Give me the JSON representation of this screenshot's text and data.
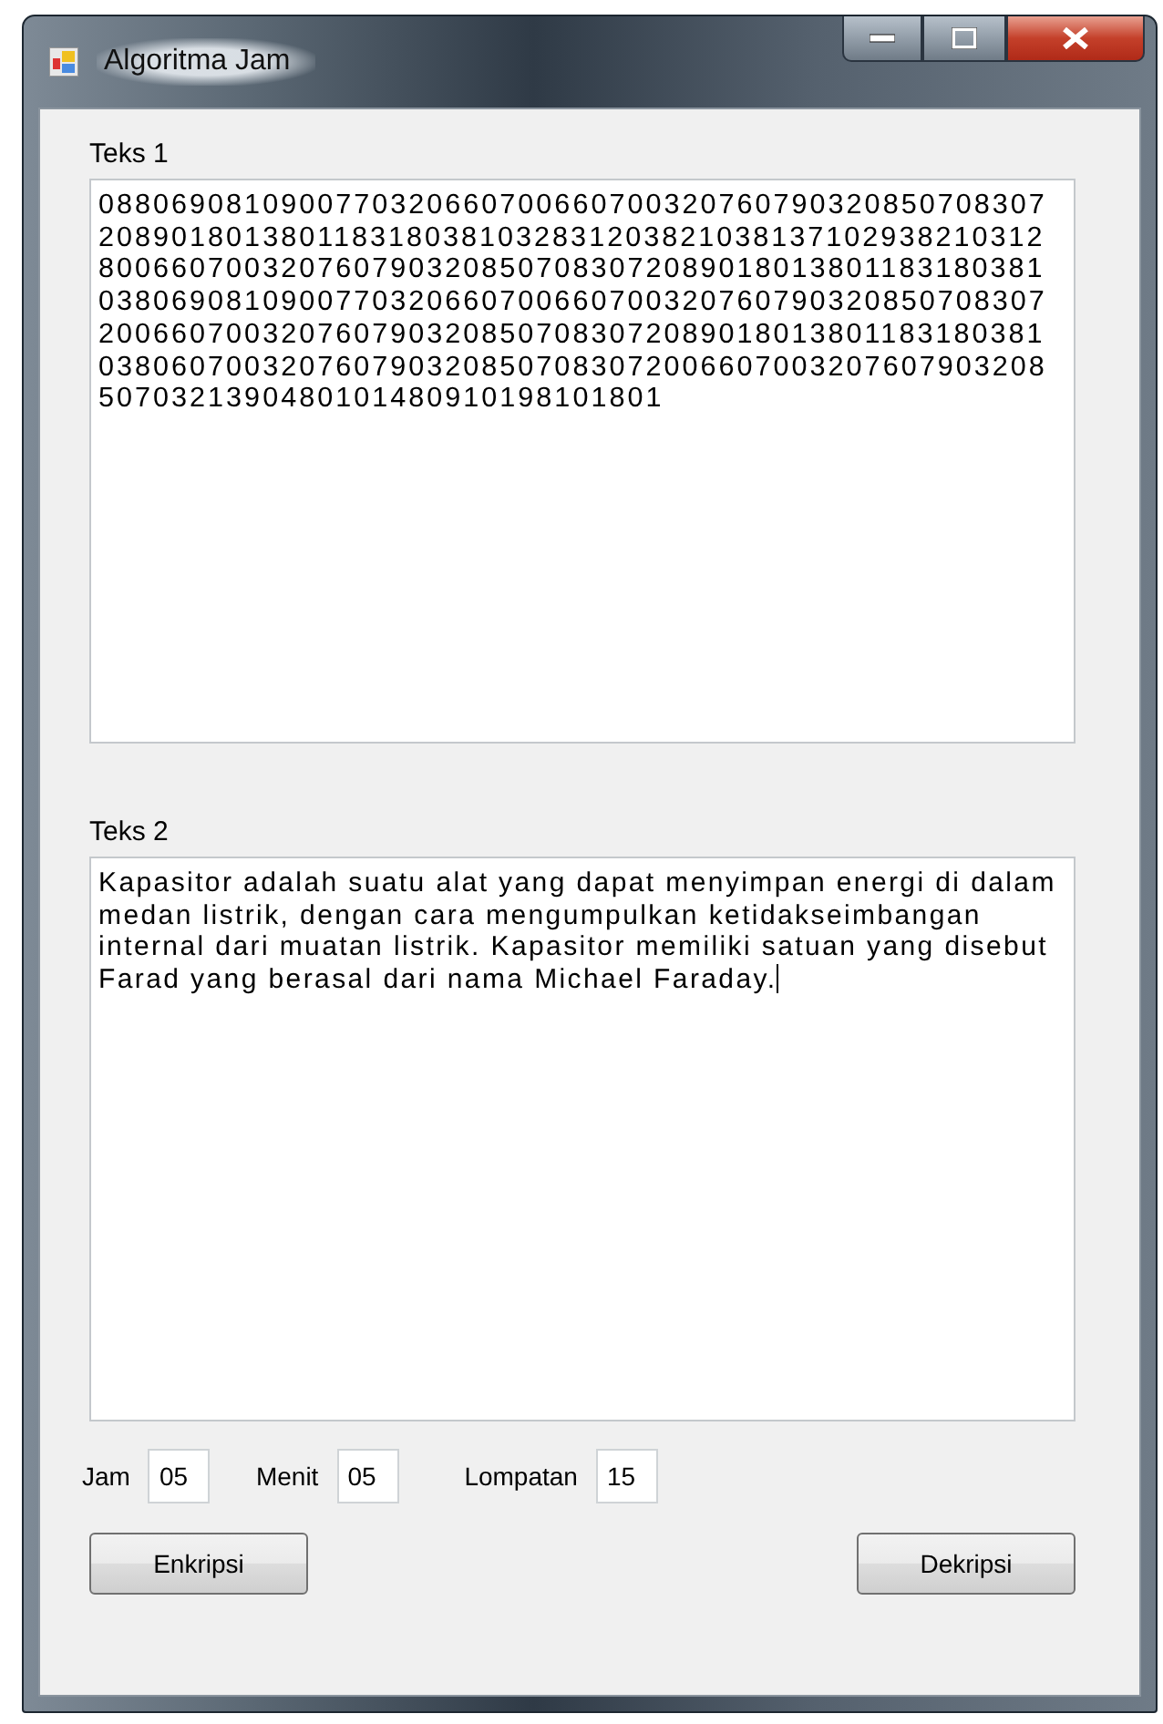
{
  "window": {
    "title": "Algoritma Jam"
  },
  "teks1": {
    "label": "Teks 1",
    "lines": [
      "0880690810900770320660700660700320760790320850708307",
      "2089018013801183180381032831203821038137102938210312",
      "8006607003207607903208507083072089018013801183180381",
      "0380690810900770320660700660700320760790320850708307",
      "2006607003207607903208507083072089018013801183180381",
      "0380607003207607903208507083072006607003207607903208",
      "5070321390480101480910198101801"
    ]
  },
  "teks2": {
    "label": "Teks 2",
    "lines": [
      "Kapasitor adalah suatu alat yang dapat menyimpan energi di dalam",
      "medan listrik, dengan cara mengumpulkan ketidakseimbangan",
      "internal dari muatan listrik. Kapasitor memiliki satuan yang disebut",
      "Farad yang berasal dari nama Michael Faraday."
    ],
    "caret": true
  },
  "fields": [
    {
      "label": "Jam",
      "value": "05"
    },
    {
      "label": "Menit",
      "value": "05"
    },
    {
      "label": "Lompatan",
      "value": "15"
    }
  ],
  "buttons": [
    "Enkripsi",
    "Dekripsi"
  ]
}
